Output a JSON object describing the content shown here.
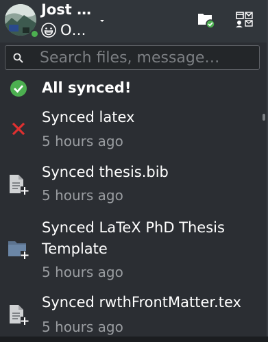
{
  "header": {
    "user_name": "Jost …",
    "user_status_text": "O…",
    "status_color": "#4caf50",
    "icons": {
      "avatar": "avatar",
      "status_emoji": "grinning-face-emoji",
      "dropdown": "chevron-down-icon",
      "files": "folder-synced-icon",
      "apps": "apps-icon"
    }
  },
  "search": {
    "placeholder": "Search files, message…",
    "value": ""
  },
  "activities": [
    {
      "title": "All synced!",
      "time": "",
      "icon": "check-circle-icon",
      "bold": true
    },
    {
      "title": "Synced latex",
      "time": "5 hours ago",
      "icon": "error-x-icon",
      "bold": false
    },
    {
      "title": "Synced thesis.bib",
      "time": "5 hours ago",
      "icon": "file-added-icon",
      "bold": false
    },
    {
      "title": "Synced LaTeX PhD Thesis Template",
      "time": "5 hours ago",
      "icon": "folder-added-icon",
      "bold": false
    },
    {
      "title": "Synced rwthFrontMatter.tex",
      "time": "5 hours ago",
      "icon": "file-added-icon",
      "bold": false
    }
  ],
  "colors": {
    "accent_green": "#4caf50",
    "error_red": "#e03030",
    "background": "#2b2e33",
    "header": "#31363b",
    "secondary_text": "#9a9da1"
  }
}
